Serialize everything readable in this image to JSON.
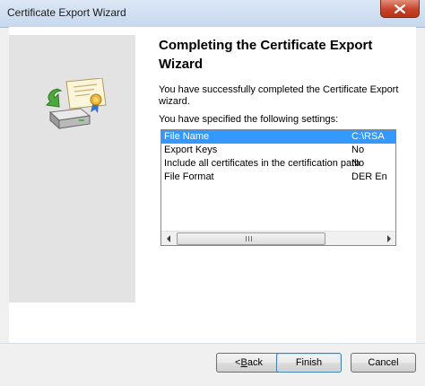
{
  "window": {
    "title": "Certificate Export Wizard"
  },
  "wizard": {
    "heading": "Completing the Certificate Export Wizard",
    "description": "You have successfully completed the Certificate Export wizard.",
    "settings_label": "You have specified the following settings:"
  },
  "settings": {
    "rows": [
      {
        "name": "File Name",
        "value": "C:\\RSA",
        "selected": true
      },
      {
        "name": "Export Keys",
        "value": "No",
        "selected": false
      },
      {
        "name": "Include all certificates in the certification path",
        "value": "No",
        "selected": false
      },
      {
        "name": "File Format",
        "value": "DER En",
        "selected": false
      }
    ]
  },
  "buttons": {
    "back_prefix": "< ",
    "back_mnemonic": "B",
    "back_rest": "ack",
    "finish": "Finish",
    "cancel": "Cancel"
  },
  "colors": {
    "selection": "#3399ff",
    "panel": "#e3e3e3",
    "close_button": "#c8432a"
  }
}
